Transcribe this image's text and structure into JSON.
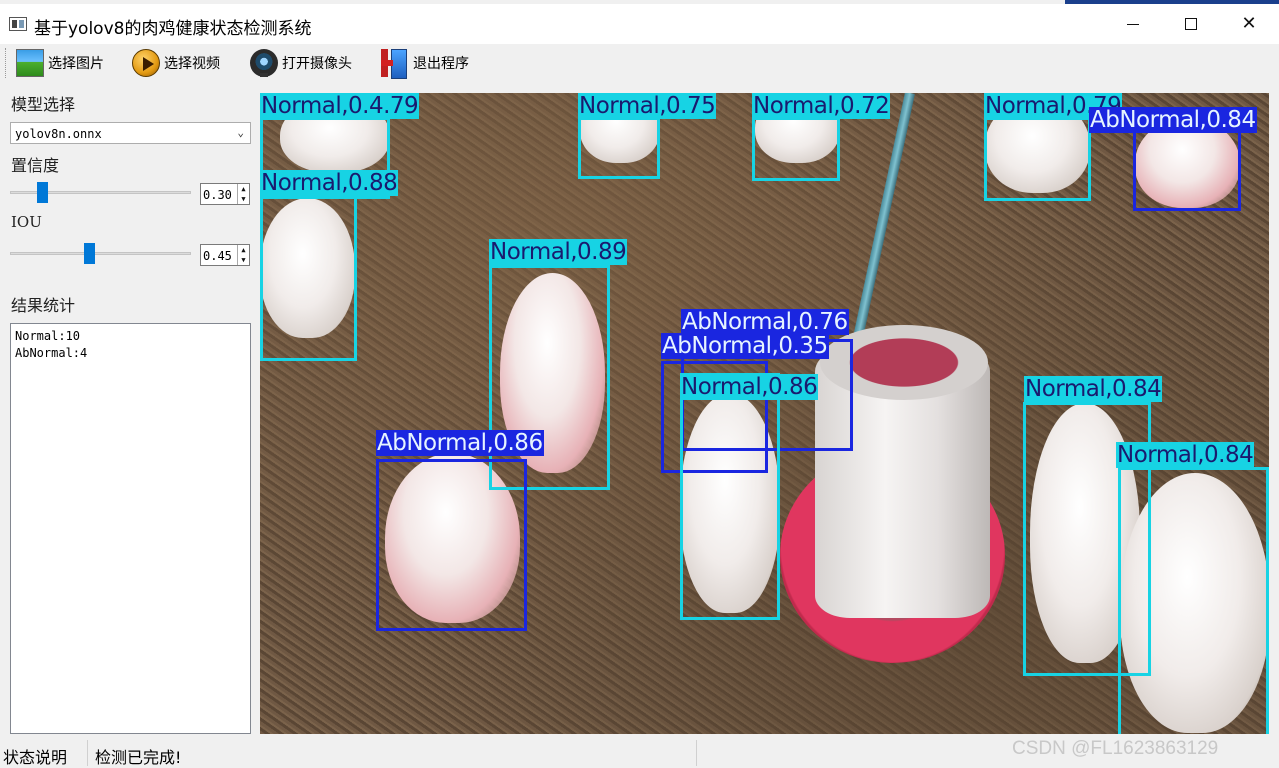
{
  "window": {
    "title": "基于yolov8的肉鸡健康状态检测系统",
    "minimize_label": "—",
    "close_label": "✕"
  },
  "toolbar": {
    "items": [
      {
        "label": "选择图片",
        "icon": "image-icon"
      },
      {
        "label": "选择视频",
        "icon": "video-play-icon"
      },
      {
        "label": "打开摄像头",
        "icon": "webcam-icon"
      },
      {
        "label": "退出程序",
        "icon": "exit-door-icon"
      }
    ]
  },
  "panel": {
    "model_label": "模型选择",
    "model_value": "yolov8n.onnx",
    "conf_label": "置信度",
    "conf_value": "0.30",
    "conf_fraction": 0.3,
    "iou_label": "IOU",
    "iou_value": "0.45",
    "iou_fraction": 0.45,
    "result_label": "结果统计",
    "result_lines": [
      "Normal:10",
      "AbNormal:4"
    ]
  },
  "detections": [
    {
      "label": "Normal,0.4.79",
      "cls": "normal"
    },
    {
      "label": "Normal,0.75",
      "cls": "normal"
    },
    {
      "label": "Normal,0.72",
      "cls": "normal"
    },
    {
      "label": "Normal,0.79",
      "cls": "normal"
    },
    {
      "label": "AbNormal,0.84",
      "cls": "abnormal"
    },
    {
      "label": "Normal,0.88",
      "cls": "normal"
    },
    {
      "label": "Normal,0.89",
      "cls": "normal"
    },
    {
      "label": "AbNormal,0.76",
      "cls": "abnormal"
    },
    {
      "label": "AbNormal,0.35",
      "cls": "abnormal"
    },
    {
      "label": "Normal,0.86",
      "cls": "normal"
    },
    {
      "label": "AbNormal,0.86",
      "cls": "abnormal"
    },
    {
      "label": "Normal,0.84",
      "cls": "normal"
    },
    {
      "label": "Normal,0.84",
      "cls": "normal"
    }
  ],
  "status": {
    "label": "状态说明",
    "text": "检测已完成!"
  },
  "watermark": "CSDN @FL1623863129",
  "colors": {
    "normal_box": "#17d3e4",
    "abnormal_box": "#1a26e0",
    "slider_handle": "#0078d7"
  }
}
